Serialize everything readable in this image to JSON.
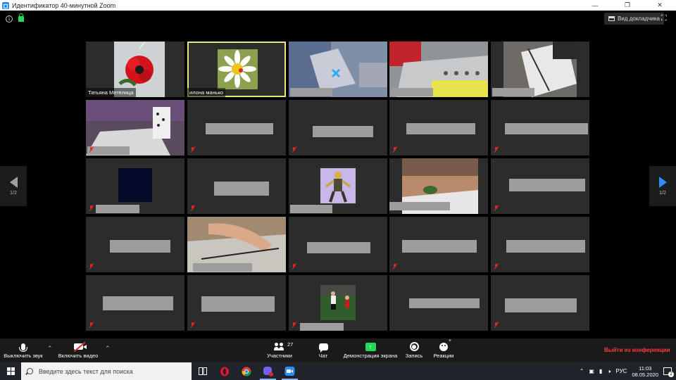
{
  "window": {
    "title": "Идентификатор 40-минутной Zoom",
    "controls": [
      "minimize-icon",
      "restore-icon",
      "close-icon"
    ]
  },
  "meeting_bar": {
    "speaker_view_label": "Вид докладчика",
    "icons": [
      "info-icon",
      "lock-icon",
      "fullscreen-icon"
    ]
  },
  "gallery": {
    "page_indicator_left": "1/2",
    "page_indicator_right": "1/2",
    "tiles": [
      {
        "name": "Татьяна Метелица",
        "kind": "flower-red",
        "muted": false,
        "active": false
      },
      {
        "name": "илона манько",
        "kind": "flower-daisy",
        "muted": false,
        "active": true
      },
      {
        "name": "",
        "kind": "video-paper-blue",
        "muted": false,
        "active": false
      },
      {
        "name": "",
        "kind": "video-paper-red",
        "muted": false,
        "active": false
      },
      {
        "name": "",
        "kind": "video-paper-white",
        "muted": false,
        "active": false
      },
      {
        "name": "",
        "kind": "video-room",
        "muted": true,
        "active": false
      },
      {
        "name": "",
        "kind": "blank",
        "muted": true,
        "active": false
      },
      {
        "name": "",
        "kind": "blank",
        "muted": true,
        "active": false
      },
      {
        "name": "",
        "kind": "blank",
        "muted": true,
        "active": false
      },
      {
        "name": "",
        "kind": "blank",
        "muted": true,
        "active": false
      },
      {
        "name": "",
        "kind": "avatar-dark",
        "muted": true,
        "active": false
      },
      {
        "name": "",
        "kind": "blank",
        "muted": true,
        "active": false
      },
      {
        "name": "",
        "kind": "avatar-figure",
        "muted": false,
        "active": false
      },
      {
        "name": "",
        "kind": "video-floor",
        "muted": false,
        "active": false
      },
      {
        "name": "",
        "kind": "blank",
        "muted": true,
        "active": false
      },
      {
        "name": "",
        "kind": "blank",
        "muted": true,
        "active": false
      },
      {
        "name": "",
        "kind": "video-hand",
        "muted": false,
        "active": false
      },
      {
        "name": "",
        "kind": "blank",
        "muted": true,
        "active": false
      },
      {
        "name": "",
        "kind": "blank",
        "muted": true,
        "active": false
      },
      {
        "name": "",
        "kind": "blank",
        "muted": true,
        "active": false
      },
      {
        "name": "",
        "kind": "blank",
        "muted": true,
        "active": false
      },
      {
        "name": "",
        "kind": "blank",
        "muted": true,
        "active": false
      },
      {
        "name": "",
        "kind": "avatar-football",
        "muted": true,
        "active": false
      },
      {
        "name": "",
        "kind": "blank",
        "muted": false,
        "active": false
      },
      {
        "name": "",
        "kind": "blank",
        "muted": true,
        "active": false
      }
    ]
  },
  "toolbar": {
    "mute_label": "Выключить звук",
    "video_label": "Включить видео",
    "participants_label": "Участники",
    "participants_count": "27",
    "chat_label": "Чат",
    "share_label": "Демонстрация экрана",
    "record_label": "Запись",
    "reactions_label": "Реакции",
    "leave_label": "Выйти из конференции",
    "share_icon_glyph": "↑"
  },
  "taskbar": {
    "search_placeholder": "Введите здесь текст для поиска",
    "apps": [
      "task-view-icon",
      "opera-icon",
      "chrome-icon",
      "viber-icon",
      "zoom-icon"
    ],
    "language": "РУС",
    "time": "11:03",
    "date": "08.05.2020",
    "notification_count": "2"
  },
  "colors": {
    "accent_blue": "#2d8cff",
    "share_green": "#23d959",
    "leave_red": "#ff3b3b",
    "active_outline": "#e6e87a",
    "tile_bg": "#2c2c2c"
  }
}
